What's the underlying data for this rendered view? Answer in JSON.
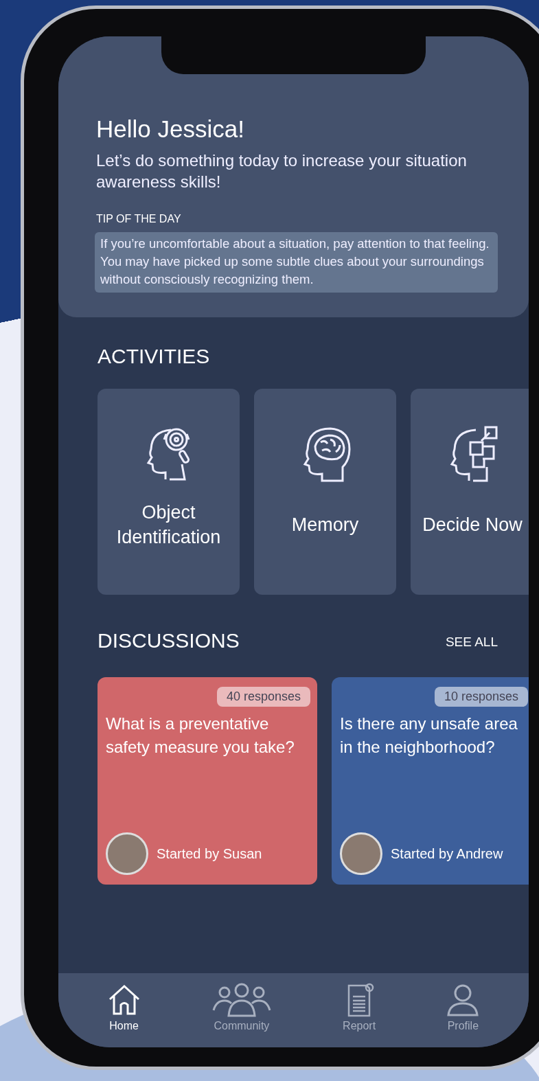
{
  "greeting": {
    "title": "Hello Jessica!",
    "subtitle": "Let’s do something today to increase your situation awareness skills!"
  },
  "tip": {
    "label": "TIP OF THE DAY",
    "text": "If you’re uncomfortable about a situation, pay attention to that feeling. You may have picked up some subtle clues about your surroundings without consciously recognizing them."
  },
  "activities": {
    "title": "ACTIVITIES",
    "items": [
      {
        "kind": "search",
        "label": "Object Identification"
      },
      {
        "kind": "brain",
        "label": "Memory"
      },
      {
        "kind": "puzzle",
        "label": "Decide Now"
      }
    ]
  },
  "discussions": {
    "title": "DISCUSSIONS",
    "see_all": "SEE ALL",
    "items": [
      {
        "responses": "40 responses",
        "question": "What is a preventative safety measure you take?",
        "starter": "Started by Susan",
        "color": "#d0676a"
      },
      {
        "responses": "10 responses",
        "question": "Is there any unsafe area in the neighborhood?",
        "starter": "Started by Andrew",
        "color": "#3d5f9b"
      }
    ]
  },
  "nav": [
    {
      "kind": "home",
      "label": "Home",
      "selected": true
    },
    {
      "kind": "community",
      "label": "Community",
      "selected": false
    },
    {
      "kind": "report",
      "label": "Report",
      "selected": false
    },
    {
      "kind": "profile",
      "label": "Profile",
      "selected": false
    }
  ]
}
